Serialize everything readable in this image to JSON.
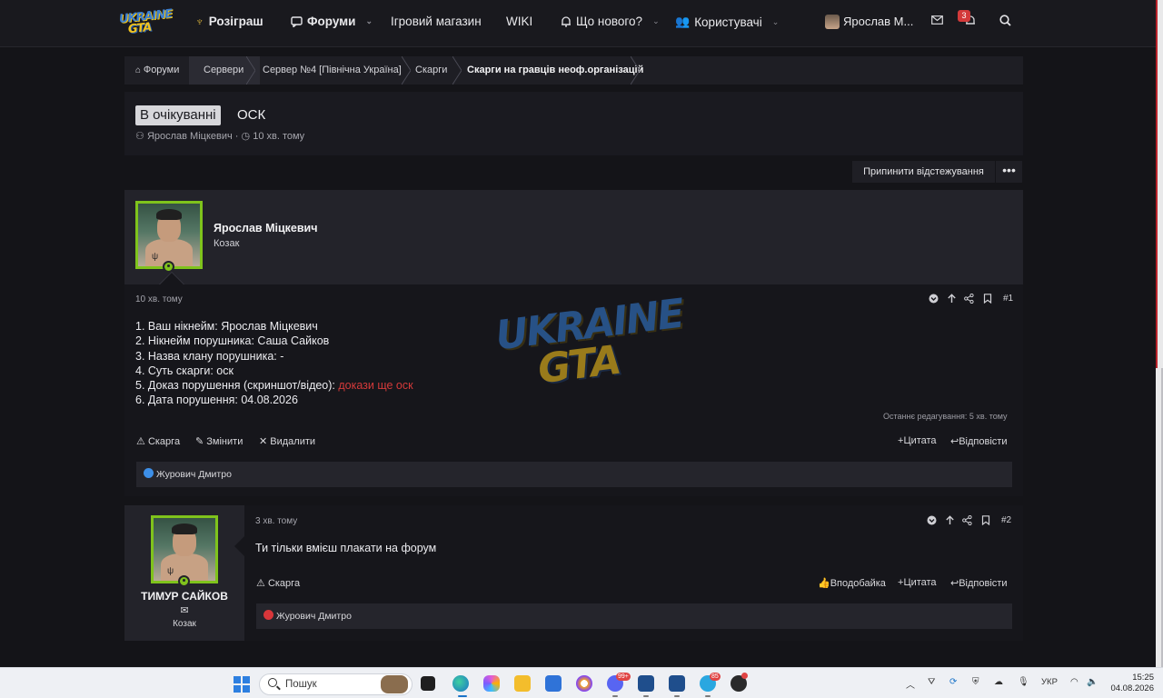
{
  "nav": {
    "giveaway": "Розіграш",
    "forums": "Форуми",
    "shop": "Ігровий магазин",
    "wiki": "WIKI",
    "whats_new": "Що нового?",
    "users": "Користувачі",
    "username": "Ярослав М...",
    "alerts_count": "3"
  },
  "breadcrumb": [
    "Форуми",
    "Сервери",
    "Сервер №4 [Північна Україна]",
    "Скарги",
    "Скарги на гравців неоф.організацій"
  ],
  "thread": {
    "prefix": "В очікуванні",
    "title": "ОСК",
    "author": "Ярослав Міцкевич",
    "time": "10 хв. тому"
  },
  "follow": {
    "unwatch_label": "Припинити відстежування",
    "more": "•••"
  },
  "post1": {
    "author": "Ярослав Міцкевич",
    "role": "Козак",
    "time": "10 хв. тому",
    "number": "#1",
    "lines": [
      "1. Ваш нікнейм: Ярослав Міцкевич",
      "2. Нікнейм порушника: Саша Сайков",
      "3. Назва клану порушника: -",
      "4. Суть скарги: оск"
    ],
    "line5_prefix": "5. Доказ порушення (скриншот/відео): ",
    "line5_link": "докази ще оск",
    "line6": "6. Дата порушення: 04.08.2026",
    "edited": "Останнє редагування: 5 хв. тому",
    "actions": {
      "report": "Скарга",
      "edit": "Змінити",
      "delete": "Видалити",
      "quote": "Цитата",
      "reply": "Відповісти"
    },
    "reaction_user": "Журович Дмитро"
  },
  "watermark": {
    "line1": "UKRAINE",
    "line2": "GTA"
  },
  "post2": {
    "author": "ТИМУР САЙКОВ",
    "role": "Козак",
    "time": "3 хв. тому",
    "number": "#2",
    "text": "Ти тільки вмієш плакати на форум",
    "actions": {
      "report": "Скарга",
      "like": "Вподобайка",
      "quote": "Цитата",
      "reply": "Відповісти"
    },
    "reaction_user": "Журович Дмитро"
  },
  "logo": {
    "line1": "UKRAINE",
    "line2": "GTA"
  },
  "taskbar": {
    "search_placeholder": "Пошук",
    "lang": "УКР",
    "time": "15:25",
    "date": "04.08.2026",
    "badge1": "99+",
    "badge2": "85"
  },
  "colors": {
    "accent_green": "#7fc31c",
    "link_red": "#d53a3a",
    "bg": "#141418"
  }
}
